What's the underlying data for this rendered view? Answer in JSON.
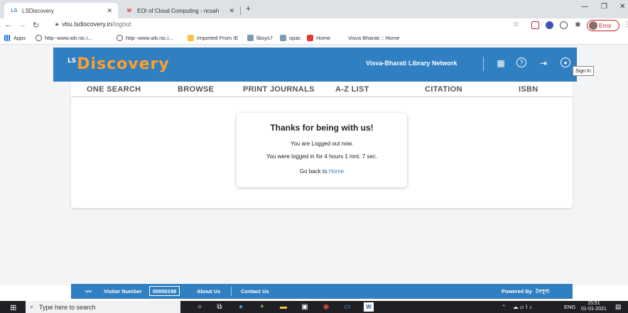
{
  "browser": {
    "tabs": [
      {
        "label": "LSDiscovery",
        "favicon": "LS",
        "active": true
      },
      {
        "label": "EOI of Cloud Computing - ncsah",
        "favicon": "M",
        "active": false
      }
    ],
    "url_host": "vbu.lsdiscovery.in",
    "url_path": "/logout",
    "error_label": "Error",
    "bookmarks": [
      "Apps",
      "http--www.wb.nic.i...",
      "http--www.wb.nic.i...",
      "Imported From IE",
      "libsys7",
      "opac",
      "Home",
      "Visva Bharati :: Home"
    ]
  },
  "header": {
    "logo_prefix": "LS",
    "logo_text": "Discovery",
    "network": "Visva-Bharati Library Network",
    "tooltip": "Sign In"
  },
  "nav": {
    "items": [
      "ONE SEARCH",
      "BROWSE",
      "PRINT JOURNALS",
      "A-Z LIST",
      "CITATION",
      "ISBN"
    ]
  },
  "card": {
    "title": "Thanks for being with us!",
    "line1": "You are Logged out now.",
    "line2": "You were logged in for  4 hours 1 mnt. 7 sec.",
    "line3_prefix": "Go back to",
    "home_link": "Home"
  },
  "footer": {
    "visitor_label": "Visitor Number",
    "visitor_number": "00000198",
    "about": "About Us",
    "contact": "Contact Us",
    "powered": "Powered By",
    "powered_brand": "নৈপুণ্য"
  },
  "taskbar": {
    "search_placeholder": "Type here to search",
    "language": "ENG",
    "time": "15:51",
    "date": "01-01-2021"
  },
  "colors": {
    "brand_blue": "#2f7fc1",
    "logo_orange": "#ff9f2e"
  }
}
